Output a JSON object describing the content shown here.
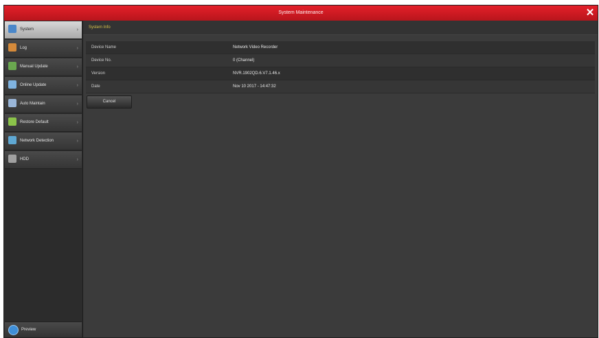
{
  "window": {
    "title": "System Maintenance",
    "close_glyph": "✕"
  },
  "sidebar": {
    "items": [
      {
        "label": "System",
        "icon": "monitor-icon",
        "color": "#4a87c9",
        "active": true
      },
      {
        "label": "Log",
        "icon": "log-icon",
        "color": "#d58a3a"
      },
      {
        "label": "Manual Update",
        "icon": "update-icon",
        "color": "#6aa84f"
      },
      {
        "label": "Online Update",
        "icon": "cloud-icon",
        "color": "#7fb3e0"
      },
      {
        "label": "Auto Maintain",
        "icon": "tools-icon",
        "color": "#9ab6d8"
      },
      {
        "label": "Restore Default",
        "icon": "shield-icon",
        "color": "#8bc34a"
      },
      {
        "label": "Network Detection",
        "icon": "network-icon",
        "color": "#5fa8d3"
      },
      {
        "label": "HDD",
        "icon": "hdd-icon",
        "color": "#a0a0a0"
      }
    ],
    "bottom": {
      "label": "Preview",
      "icon": "preview-icon"
    }
  },
  "content": {
    "header": "System Info",
    "rows": [
      {
        "key": "Device Name",
        "value": "Network Video Recorder"
      },
      {
        "key": "Device No.",
        "value": "0 (Channel)"
      },
      {
        "key": "Version",
        "value": "NVR.1902QD.6.V7.1.46.x"
      },
      {
        "key": "Date",
        "value": "Nov 10 2017 - 14:47:32"
      }
    ],
    "cancel_label": "Cancel"
  }
}
